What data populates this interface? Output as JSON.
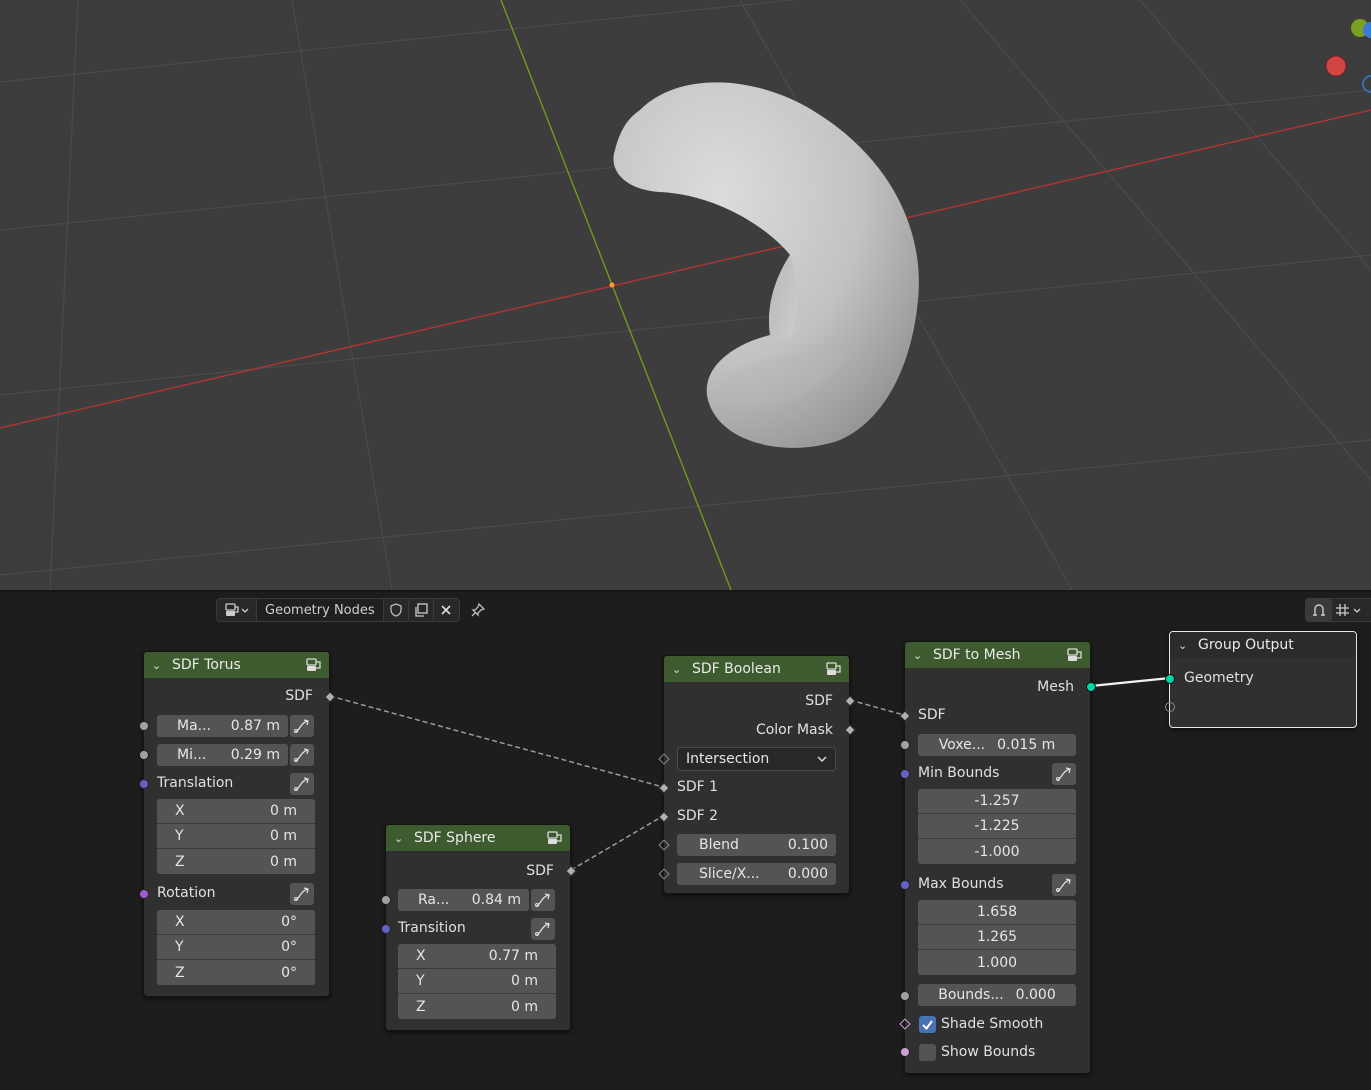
{
  "editor": {
    "tree_name": "Geometry Nodes"
  },
  "nodes": {
    "torus": {
      "title": "SDF Torus",
      "out_sdf": "SDF",
      "major_label": "Ma...",
      "major_value": "0.87 m",
      "minor_label": "Mi...",
      "minor_value": "0.29 m",
      "translation_label": "Translation",
      "translation": [
        {
          "axis": "X",
          "value": "0 m"
        },
        {
          "axis": "Y",
          "value": "0 m"
        },
        {
          "axis": "Z",
          "value": "0 m"
        }
      ],
      "rotation_label": "Rotation",
      "rotation": [
        {
          "axis": "X",
          "value": "0°"
        },
        {
          "axis": "Y",
          "value": "0°"
        },
        {
          "axis": "Z",
          "value": "0°"
        }
      ]
    },
    "sphere": {
      "title": "SDF Sphere",
      "out_sdf": "SDF",
      "radius_label": "Ra...",
      "radius_value": "0.84 m",
      "transition_label": "Transition",
      "transition": [
        {
          "axis": "X",
          "value": "0.77 m"
        },
        {
          "axis": "Y",
          "value": "0 m"
        },
        {
          "axis": "Z",
          "value": "0 m"
        }
      ]
    },
    "boolean": {
      "title": "SDF Boolean",
      "out_sdf": "SDF",
      "out_color_mask": "Color Mask",
      "operation": "Intersection",
      "in_sdf1": "SDF 1",
      "in_sdf2": "SDF 2",
      "blend_label": "Blend",
      "blend_value": "0.100",
      "slice_label": "Slice/X...",
      "slice_value": "0.000"
    },
    "to_mesh": {
      "title": "SDF to Mesh",
      "out_mesh": "Mesh",
      "in_sdf": "SDF",
      "voxel_label": "Voxe...",
      "voxel_value": "0.015 m",
      "min_bounds_label": "Min Bounds",
      "min_bounds": [
        "-1.257",
        "-1.225",
        "-1.000"
      ],
      "max_bounds_label": "Max Bounds",
      "max_bounds": [
        "1.658",
        "1.265",
        "1.000"
      ],
      "bounds_pad_label": "Bounds...",
      "bounds_pad_value": "0.000",
      "shade_smooth_label": "Shade Smooth",
      "shade_smooth": true,
      "show_bounds_label": "Show Bounds",
      "show_bounds": false
    },
    "group_output": {
      "title": "Group Output",
      "in_geometry": "Geometry"
    }
  },
  "colors": {
    "node_header_green": "#3d5b2f",
    "socket_gray": "#a1a1a1",
    "socket_vector": "#6363c7",
    "socket_rotation": "#a15ad0",
    "socket_geometry": "#00d6a3",
    "socket_bool": "#d2a0d8",
    "axis_x": "#c23a3a",
    "axis_y": "#7a9a1f",
    "checkbox_on": "#4772b3"
  },
  "icons": {
    "editor_type": "node-editor-icon",
    "fake_user": "shield-icon",
    "duplicate": "duplicate-icon",
    "unlink": "close-icon",
    "pin": "pin-icon",
    "snap": "snap-icon",
    "overlay": "grid-overlay-icon",
    "field_link": "driver-curve-icon",
    "node_group": "node-group-icon"
  }
}
